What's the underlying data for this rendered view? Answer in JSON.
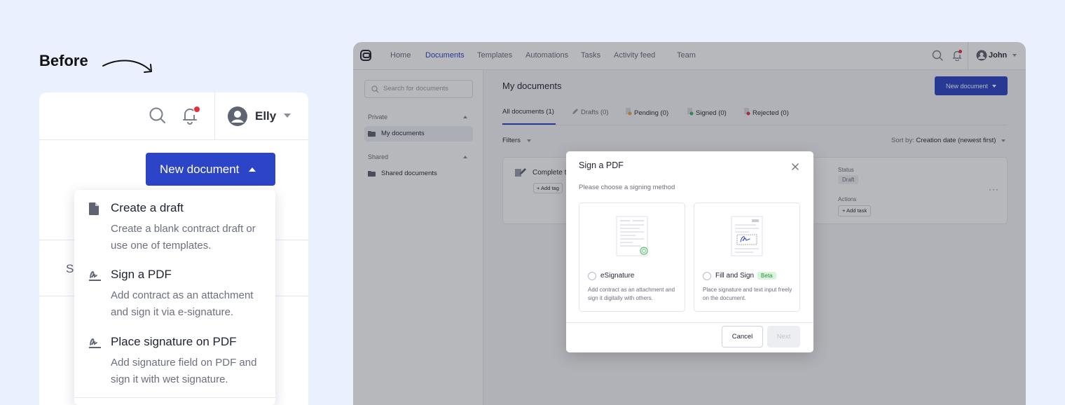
{
  "before": {
    "label": "Before"
  },
  "left": {
    "user_name": "Elly",
    "new_document_label": "New document",
    "peek_letter": "S",
    "dropdown": [
      {
        "title": "Create a draft",
        "desc": "Create a blank contract draft or use one of templates.",
        "icon": "file-icon"
      },
      {
        "title": "Sign a PDF",
        "desc": "Add contract as an attachment and sign it via e-signature.",
        "icon": "signature-icon"
      },
      {
        "title": "Place signature on PDF",
        "desc": "Add signature field on PDF and sign it with wet signature.",
        "icon": "signature-icon"
      }
    ]
  },
  "app": {
    "nav": [
      "Home",
      "Documents",
      "Templates",
      "Automations",
      "Tasks",
      "Activity feed",
      "Team"
    ],
    "active_nav": "Documents",
    "user_name": "John",
    "sidebar": {
      "search_placeholder": "Search for documents",
      "private_label": "Private",
      "my_documents": "My documents",
      "shared_label": "Shared",
      "shared_documents": "Shared documents"
    },
    "main": {
      "title": "My documents",
      "new_document_label": "New document",
      "tabs": [
        "All documents (1)",
        "Drafts (0)",
        "Pending (0)",
        "Signed (0)",
        "Rejected (0)"
      ],
      "filters_label": "Filters",
      "sort_prefix": "Sort by:",
      "sort_value": "Creation date (newest first)",
      "doc": {
        "name": "Complete t",
        "add_tag": "+ Add tag",
        "status_label": "Status",
        "status_value": "Draft",
        "actions_label": "Actions",
        "add_task": "+ Add task",
        "more": "···"
      }
    },
    "modal": {
      "title": "Sign a PDF",
      "subtitle": "Please choose a signing method",
      "options": [
        {
          "title": "eSignature",
          "desc": "Add contract as an attachment and sign it digitally with others.",
          "badge": ""
        },
        {
          "title": "Fill and Sign",
          "desc": "Place signature and text input freely on the document.",
          "badge": "Beta"
        }
      ],
      "cancel_label": "Cancel",
      "next_label": "Next"
    }
  },
  "colors": {
    "accent": "#2c44c8",
    "background": "#eaf0fe",
    "notification": "#e5303a",
    "beta_bg": "#d8f5dc"
  }
}
